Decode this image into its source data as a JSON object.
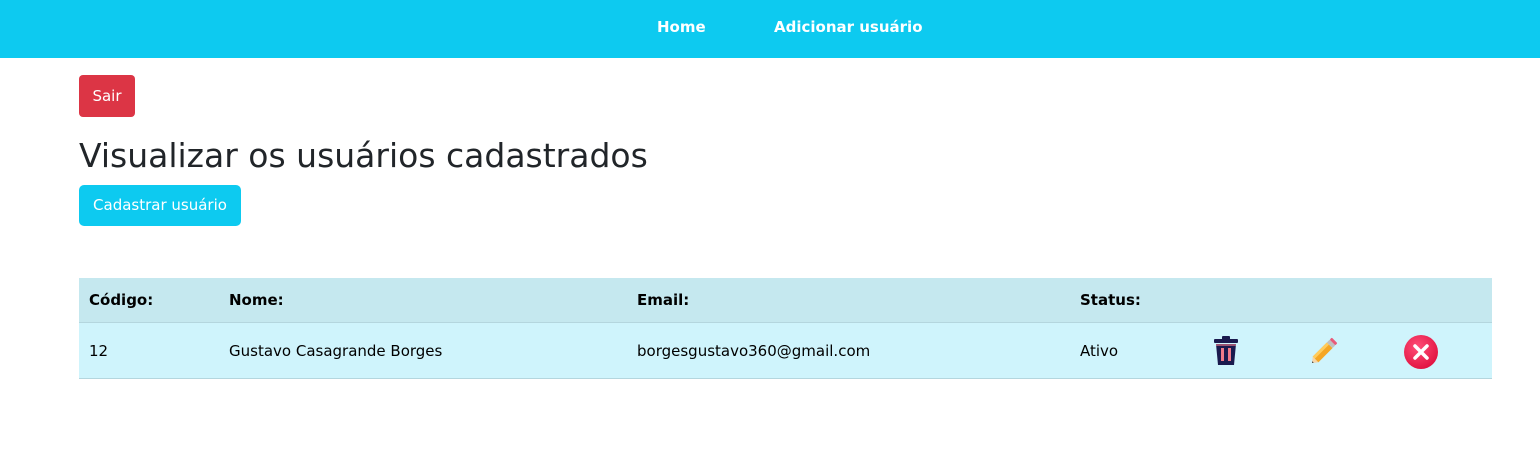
{
  "navbar": {
    "background": "#0dcaf0",
    "links": [
      "Home",
      "Adicionar usuário"
    ]
  },
  "logout_button": {
    "label": "Sair",
    "color": "#dc3545"
  },
  "page_title": "Visualizar os usuários cadastrados",
  "register_button": {
    "label": "Cadastrar usuário",
    "color": "#0dcaf0"
  },
  "table": {
    "headers": [
      "Código:",
      "Nome:",
      "Email:",
      "Status:"
    ],
    "rows": [
      {
        "code": "12",
        "name": "Gustavo Casagrande Borges",
        "email": "borgesgustavo360@gmail.com",
        "status": "Ativo",
        "actions": [
          "trash-icon",
          "pencil-icon",
          "close-icon"
        ]
      }
    ]
  }
}
